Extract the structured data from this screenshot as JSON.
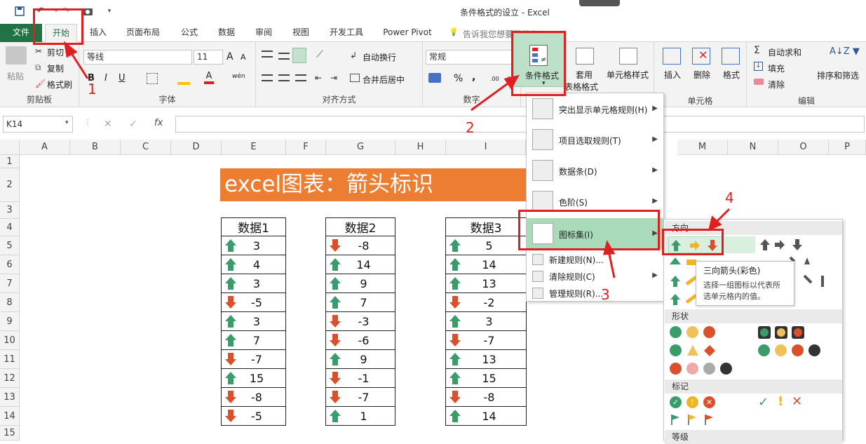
{
  "window": {
    "title": "条件格式的设立 - Excel"
  },
  "tabs": [
    "文件",
    "开始",
    "插入",
    "页面布局",
    "公式",
    "数据",
    "审阅",
    "视图",
    "开发工具",
    "Power Pivot"
  ],
  "tell_me": "告诉我您想要做什么...",
  "clipboard": {
    "paste": "粘贴",
    "cut": "剪切",
    "copy": "复制",
    "format_painter": "格式刷",
    "label": "剪贴板"
  },
  "font": {
    "name": "等线",
    "size": "11",
    "label": "字体",
    "bold": "B",
    "italic": "I",
    "underline": "U",
    "grow": "A",
    "shrink": "A",
    "wen": "wén"
  },
  "alignment": {
    "wrap": "自动换行",
    "merge": "合并后居中",
    "label": "对齐方式"
  },
  "number": {
    "format": "常规",
    "percent": "%",
    "comma": ",",
    "inc": ".00",
    "dec": ".0",
    "label": "数字"
  },
  "styles": {
    "conditional": "条件格式",
    "table_l1": "套用",
    "table_l2": "表格格式",
    "cell_style": "单元格样式"
  },
  "cells": {
    "insert": "插入",
    "delete": "删除",
    "format": "格式",
    "label": "单元格"
  },
  "editing": {
    "autosum": "自动求和",
    "fill": "填充",
    "clear": "清除",
    "sort": "排序和筛选",
    "label": "编辑"
  },
  "formula_bar": {
    "namebox": "K14",
    "fx": "fx",
    "cancel": "✕",
    "enter": "✓"
  },
  "columns": [
    "A",
    "B",
    "C",
    "D",
    "E",
    "F",
    "G",
    "H",
    "I",
    "M",
    "N",
    "O",
    "P"
  ],
  "rows": [
    "1",
    "2",
    "3",
    "4",
    "5",
    "6",
    "7",
    "8",
    "9",
    "10",
    "11",
    "12",
    "13",
    "14",
    "15"
  ],
  "sheet": {
    "title": "excel图表：箭头标识",
    "headers": [
      "数据1",
      "数据2",
      "数据3"
    ],
    "data1": [
      3,
      4,
      3,
      -5,
      3,
      7,
      -7,
      15,
      -8,
      -5
    ],
    "data2": [
      -8,
      14,
      9,
      7,
      -3,
      -6,
      9,
      -1,
      -7,
      1
    ],
    "data3": [
      5,
      14,
      13,
      -2,
      3,
      -7,
      13,
      15,
      -8,
      14
    ]
  },
  "cf_menu": {
    "highlight": "突出显示单元格规则(H)",
    "topbottom": "项目选取规则(T)",
    "databars": "数据条(D)",
    "colorscales": "色阶(S)",
    "iconsets": "图标集(I)",
    "newrule": "新建规则(N)...",
    "clearrules": "清除规则(C)",
    "managerules": "管理规则(R)..."
  },
  "icon_panel": {
    "direction": "方向",
    "shapes": "形状",
    "indicators": "标记",
    "ratings": "等级"
  },
  "tooltip": {
    "title": "三向箭头(彩色)",
    "body_l1": "选择一组图标以代表所",
    "body_l2": "选单元格内的值。"
  },
  "annotations": [
    "1",
    "2",
    "3",
    "4"
  ],
  "colors": {
    "accent_green": "#217346",
    "title_orange": "#ed7d31",
    "arrow_green": "#3a9c6a",
    "arrow_red": "#d9502b",
    "arrow_yellow": "#f0b428",
    "highlight_green": "#a9dbbb",
    "annotation_red": "#e02020"
  }
}
